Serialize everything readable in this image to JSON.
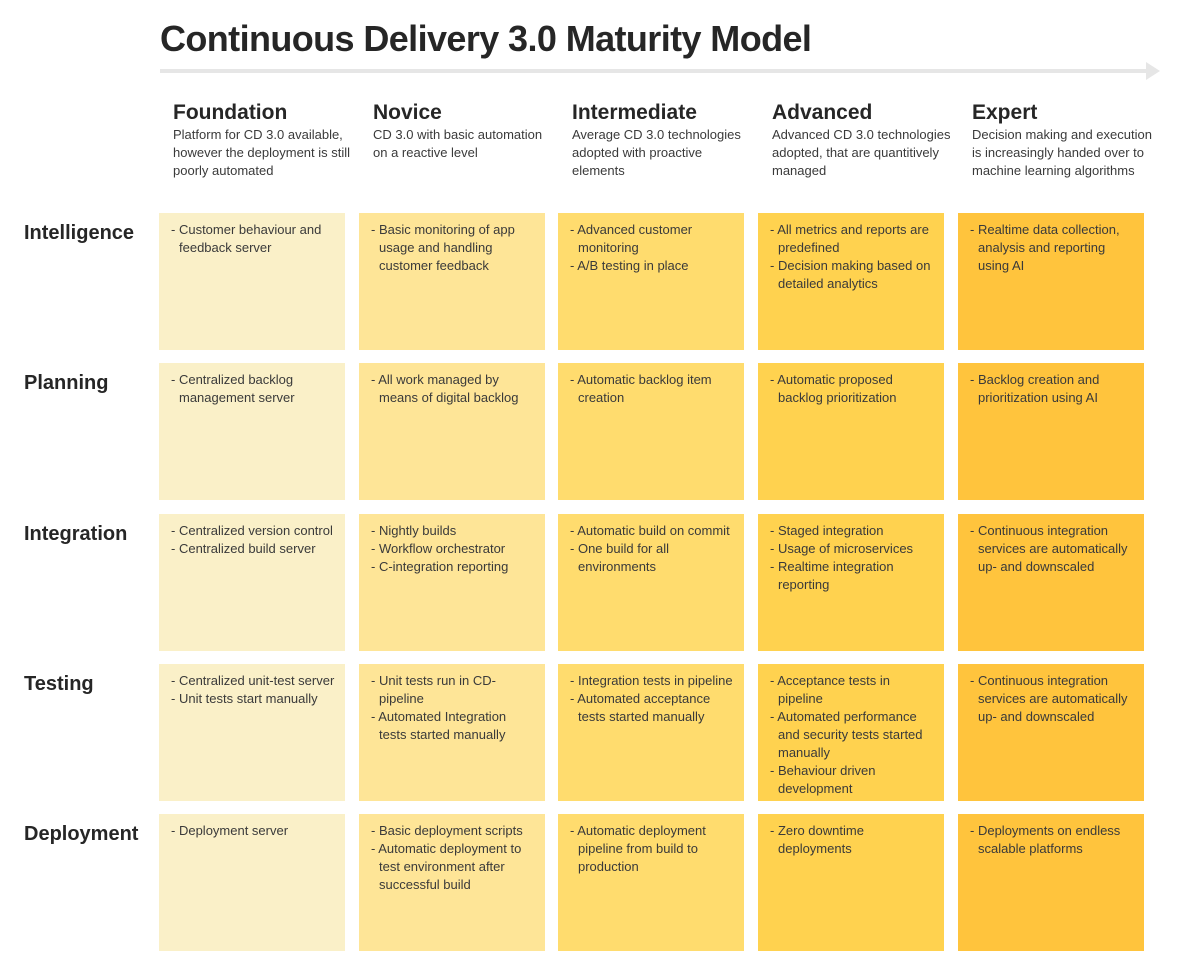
{
  "title": "Continuous Delivery 3.0 Maturity Model",
  "colors": {
    "foundation": "#faf0c8",
    "novice": "#fee597",
    "intermediate": "#ffdc6e",
    "advanced": "#ffd24f",
    "expert": "#ffc43d",
    "arrow": "#e6e6e6",
    "text": "#262626"
  },
  "levels": [
    {
      "name": "Foundation",
      "description": "Platform for CD 3.0 available, however the deployment is still poorly automated"
    },
    {
      "name": "Novice",
      "description": "CD 3.0 with basic automation on a reactive level"
    },
    {
      "name": "Intermediate",
      "description": "Average CD 3.0 technologies adopted with proactive elements"
    },
    {
      "name": "Advanced",
      "description": "Advanced CD 3.0 technologies adopted, that are quantitively managed"
    },
    {
      "name": "Expert",
      "description": "Decision making and execution is increasingly handed over to machine learning algorithms"
    }
  ],
  "rows": [
    {
      "label": "Intelligence",
      "cells": [
        [
          "Customer behaviour and feedback server"
        ],
        [
          "Basic monitoring of app usage and handling customer feedback"
        ],
        [
          "Advanced customer monitoring",
          "A/B testing in place"
        ],
        [
          "All metrics and reports are predefined",
          "Decision making based on detailed analytics"
        ],
        [
          "Realtime data collection, analysis and reporting using AI"
        ]
      ]
    },
    {
      "label": "Planning",
      "cells": [
        [
          "Centralized backlog management server"
        ],
        [
          "All work managed by means of digital backlog"
        ],
        [
          "Automatic backlog item creation"
        ],
        [
          "Automatic proposed backlog prioritization"
        ],
        [
          "Backlog creation and prioritization using AI"
        ]
      ]
    },
    {
      "label": "Integration",
      "cells": [
        [
          "Centralized version control",
          "Centralized build server"
        ],
        [
          "Nightly builds",
          "Workflow orchestrator",
          "C-integration reporting"
        ],
        [
          "Automatic build on commit",
          "One build for all environments"
        ],
        [
          "Staged integration",
          "Usage of microservices",
          "Realtime integration reporting"
        ],
        [
          "Continuous integration services are automatically up- and downscaled"
        ]
      ]
    },
    {
      "label": "Testing",
      "cells": [
        [
          "Centralized unit-test server",
          "Unit tests start manually"
        ],
        [
          "Unit tests run in CD-pipeline",
          "Automated Integration tests started manually"
        ],
        [
          "Integration tests in pipeline",
          "Automated acceptance tests started manually"
        ],
        [
          "Acceptance tests in pipeline",
          "Automated performance and security tests started manually",
          "Behaviour driven development"
        ],
        [
          "Continuous integration services are automatically up- and downscaled"
        ]
      ]
    },
    {
      "label": "Deployment",
      "cells": [
        [
          "Deployment server"
        ],
        [
          "Basic deployment scripts",
          "Automatic deployment to test environment after successful build"
        ],
        [
          "Automatic deployment pipeline from build to production"
        ],
        [
          "Zero downtime deployments"
        ],
        [
          "Deployments on endless scalable platforms"
        ]
      ]
    }
  ]
}
